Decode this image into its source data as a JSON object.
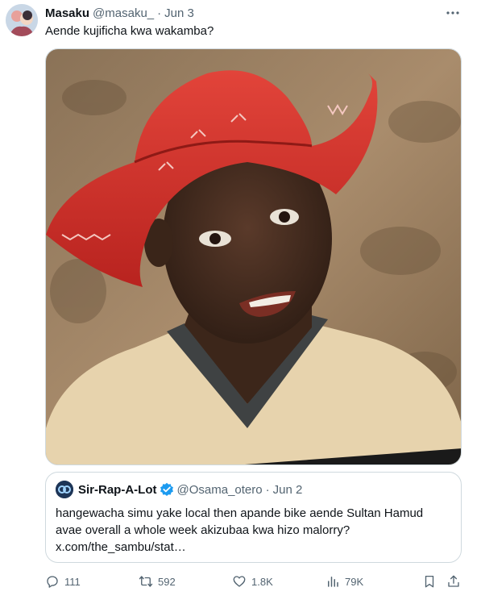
{
  "tweet": {
    "display_name": "Masaku",
    "handle": "@masaku_",
    "separator": "·",
    "time": "Jun 3",
    "text": "Aende kujificha kwa wakamba?"
  },
  "media": {
    "description_icon": "photo"
  },
  "quote": {
    "display_name": "Sir-Rap-A-Lot",
    "handle": "@Osama_otero",
    "separator": "·",
    "time": "Jun 2",
    "text_line_1": "hangewacha simu yake local then apande bike aende Sultan Hamud",
    "text_line_2": "avae overall a whole week akizubaa kwa hizo malorry?",
    "text_line_3": "x.com/the_sambu/stat…"
  },
  "actions": {
    "replies": "111",
    "reposts": "592",
    "likes": "1.8K",
    "views": "79K"
  },
  "colors": {
    "text_primary": "#0f1419",
    "text_secondary": "#536471",
    "border": "#cfd9de",
    "verified": "#1d9bf0"
  }
}
